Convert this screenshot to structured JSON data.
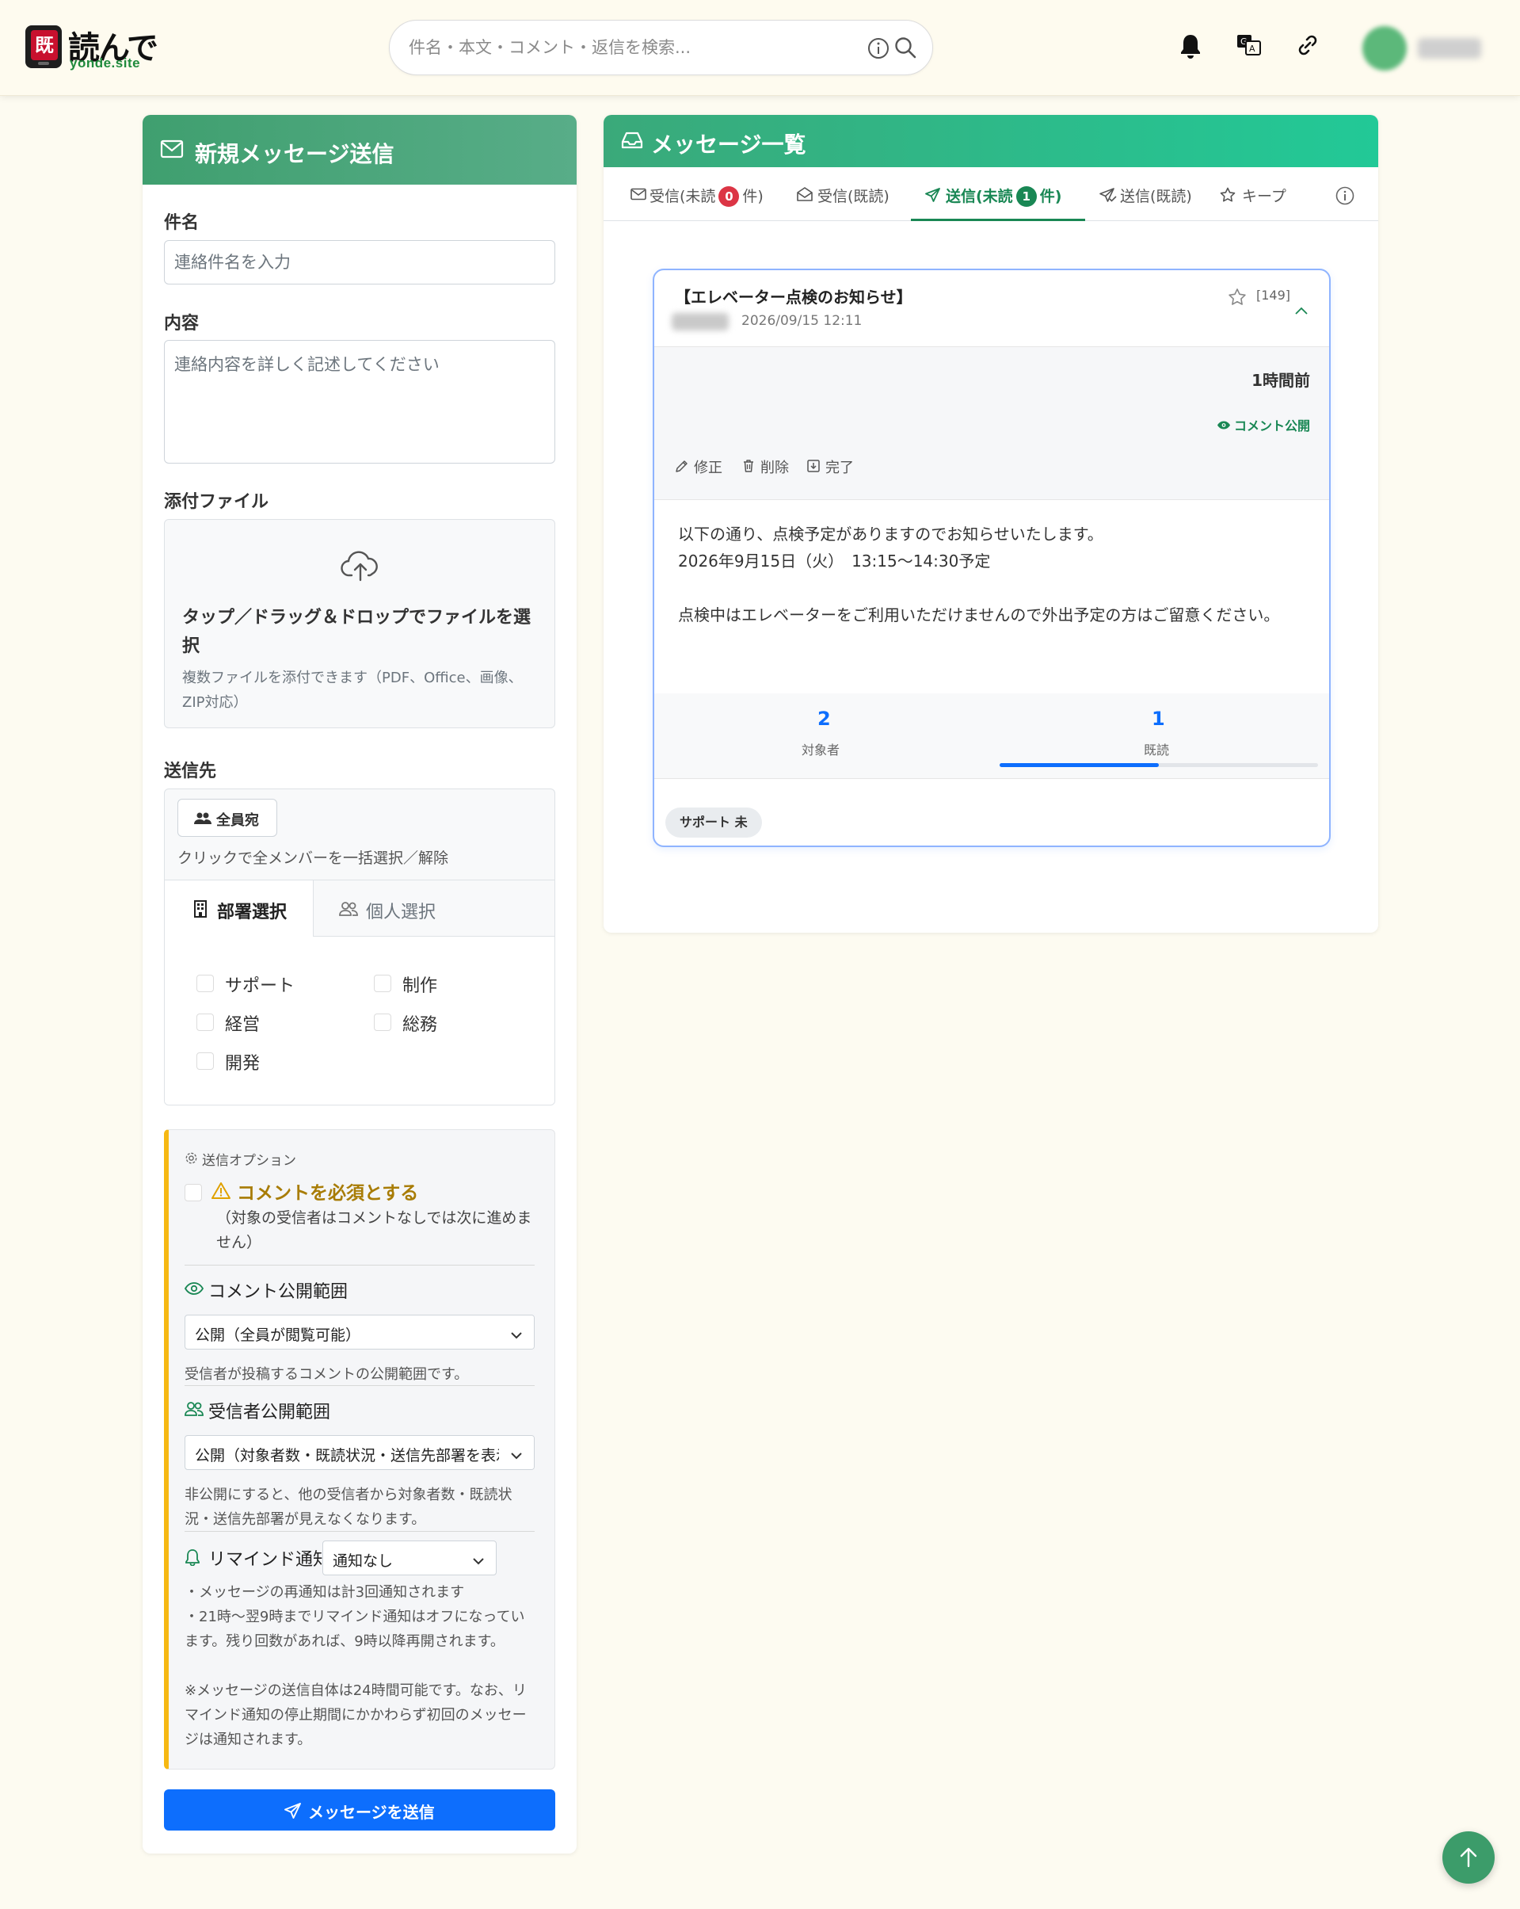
{
  "header": {
    "logo_badge": "既",
    "logo_text": "読んで",
    "logo_sub": "yonde.site",
    "search_placeholder": "件名・本文・コメント・返信を検索...",
    "user_name": "●●●●"
  },
  "compose": {
    "title": "新規メッセージ送信",
    "subject_label": "件名",
    "subject_placeholder": "連絡件名を入力",
    "content_label": "内容",
    "content_placeholder": "連絡内容を詳しく記述してください",
    "attach_label": "添付ファイル",
    "attach_title": "タップ／ドラッグ＆ドロップでファイルを選択",
    "attach_sub": "複数ファイルを添付できます（PDF、Office、画像、ZIP対応）",
    "recipients_label": "送信先",
    "all_button": "全員宛",
    "all_hint": "クリックで全メンバーを一括選択／解除",
    "tab_dept": "部署選択",
    "tab_person": "個人選択",
    "departments": [
      "サポート",
      "制作",
      "経営",
      "総務",
      "開発"
    ],
    "options": {
      "heading": "送信オプション",
      "require_comment": "コメントを必須とする",
      "require_comment_desc": "（対象の受信者はコメントなしでは次に進めません）",
      "comment_scope_label": "コメント公開範囲",
      "comment_scope_value": "公開（全員が閲覧可能）",
      "comment_scope_note": "受信者が投稿するコメントの公開範囲です。",
      "recipient_scope_label": "受信者公開範囲",
      "recipient_scope_value": "公開（対象者数・既読状況・送信先部署を表示）",
      "recipient_scope_note": "非公開にすると、他の受信者から対象者数・既読状況・送信先部署が見えなくなります。",
      "remind_label": "リマインド通知",
      "remind_value": "通知なし",
      "remind_note_1": "・メッセージの再通知は計3回通知されます",
      "remind_note_2": "・21時〜翌9時までリマインド通知はオフになっています。残り回数があれば、9時以降再開されます。",
      "remind_note_3": "※メッセージの送信自体は24時間可能です。なお、リマインド通知の停止期間にかかわらず初回のメッセージは通知されます。"
    },
    "send_button": "メッセージを送信"
  },
  "list": {
    "title": "メッセージ一覧",
    "tabs": [
      {
        "label": "受信(未読",
        "count": "0",
        "suffix": "件)"
      },
      {
        "label": "受信(既読)"
      },
      {
        "label": "送信(未読",
        "count": "1",
        "suffix": "件)"
      },
      {
        "label": "送信(既読)"
      },
      {
        "label": "キープ"
      }
    ],
    "message": {
      "title": "【エレベーター点検のお知らせ】",
      "sender": "●●●●",
      "date": "2026/09/15 12:11",
      "id": "[149]",
      "ago": "1時間前",
      "comment_public": "コメント公開",
      "actions": [
        "修正",
        "削除",
        "完了"
      ],
      "body_1": "以下の通り、点検予定がありますのでお知らせいたします。",
      "body_2": "2026年9月15日（火）　13:15〜14:30予定",
      "body_3": "点検中はエレベーターをご利用いただけませんので外出予定の方はご留意ください。",
      "target_count": "2",
      "target_label": "対象者",
      "read_count": "1",
      "read_label": "既読",
      "read_ratio": 0.5,
      "chip": "サポート 未"
    }
  },
  "colors": {
    "compose_header": "#3f9f6f",
    "list_header": "#22c997",
    "primary": "#0d6efd",
    "success": "#198754",
    "danger": "#dc3545",
    "warning": "#f6b813"
  }
}
